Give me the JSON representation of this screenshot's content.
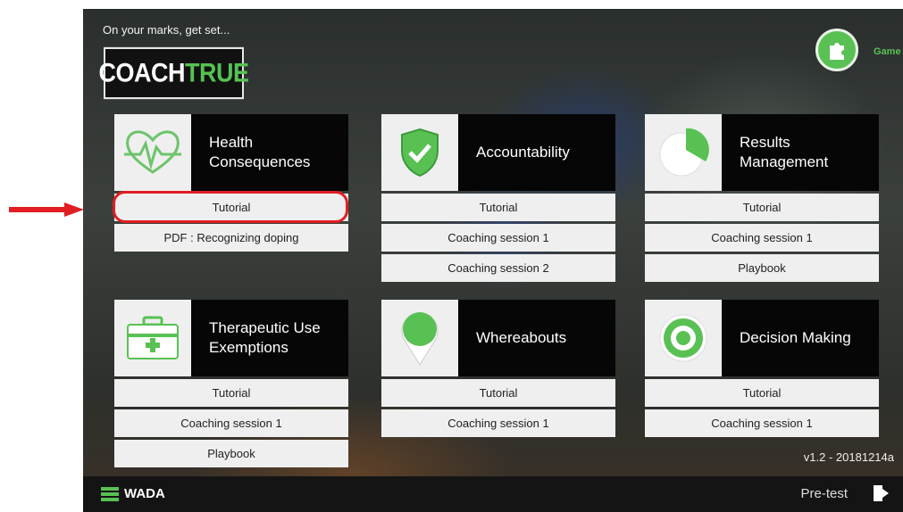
{
  "header": {
    "tagline": "On your marks, get set...",
    "logo_left": "COACH",
    "logo_right": "TRUE",
    "games_label": "Game"
  },
  "cards": [
    {
      "title": "Health Consequences",
      "icon": "heartbeat-icon",
      "items": [
        "Tutorial",
        "PDF : Recognizing doping"
      ]
    },
    {
      "title": "Accountability",
      "icon": "shield-check-icon",
      "items": [
        "Tutorial",
        "Coaching session 1",
        "Coaching session 2"
      ]
    },
    {
      "title": "Results Management",
      "icon": "pie-chart-icon",
      "items": [
        "Tutorial",
        "Coaching session 1",
        "Playbook"
      ]
    },
    {
      "title": "Therapeutic Use Exemptions",
      "icon": "first-aid-kit-icon",
      "items": [
        "Tutorial",
        "Coaching session 1",
        "Playbook"
      ]
    },
    {
      "title": "Whereabouts",
      "icon": "location-pin-icon",
      "items": [
        "Tutorial",
        "Coaching session 1"
      ]
    },
    {
      "title": "Decision Making",
      "icon": "target-icon",
      "items": [
        "Tutorial",
        "Coaching session 1"
      ]
    }
  ],
  "version": "v1.2 - 20181214a",
  "footer": {
    "brand": "WADA",
    "mode": "Pre-test"
  },
  "colors": {
    "accent_green": "#59c153",
    "annotation_red": "#e01e24"
  }
}
